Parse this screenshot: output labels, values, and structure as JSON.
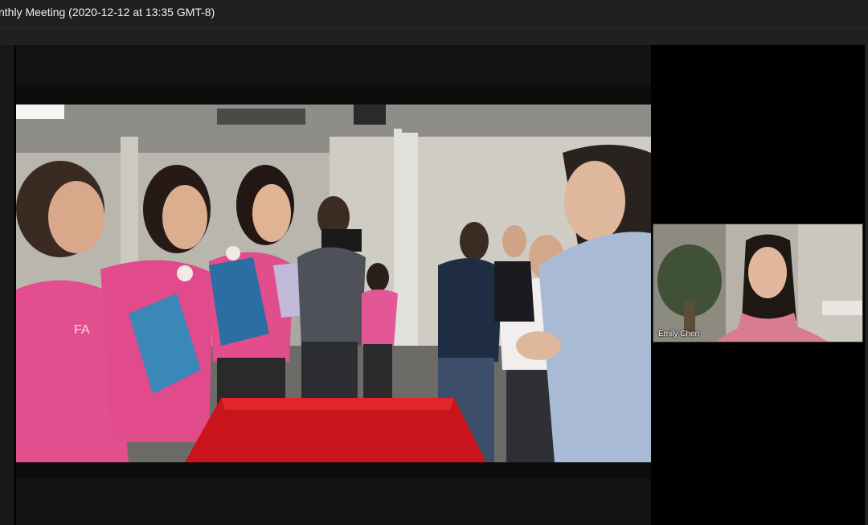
{
  "window": {
    "meeting_title": "nthly Meeting (2020-12-12 at 13:35 GMT-8)"
  },
  "participants": [
    {
      "name": "Emily Chen"
    }
  ],
  "photo": {
    "shirt_text": "FA"
  }
}
